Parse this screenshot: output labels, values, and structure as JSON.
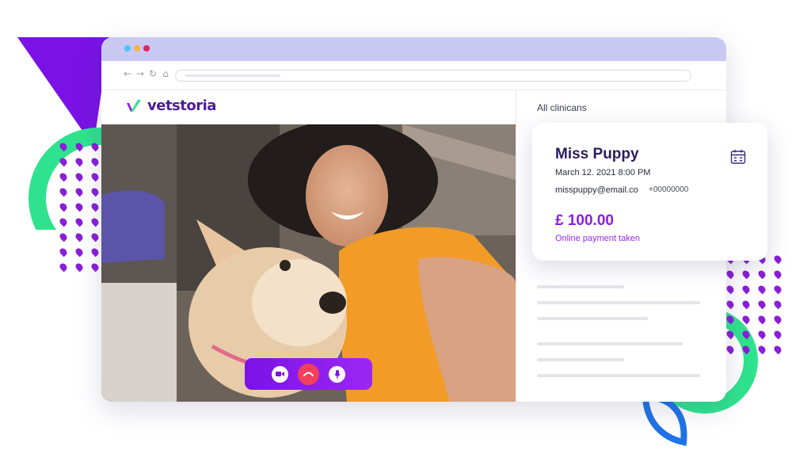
{
  "colors": {
    "brand_purple": "#4a1d9b",
    "accent_purple": "#8a1ee0",
    "titlebar": "#c9c8f3",
    "end_call_red": "#f2405b",
    "deco_green": "#2fe38e",
    "deco_blue": "#1f73e8"
  },
  "browser": {
    "window_dots": [
      "#4fc3f7",
      "#f5b342",
      "#e0245e"
    ],
    "nav_icons": [
      "back-arrow-icon",
      "forward-arrow-icon",
      "reload-icon",
      "home-icon"
    ]
  },
  "app": {
    "logo_text": "vetstoria"
  },
  "sidebar": {
    "filter_label": "All clinicans"
  },
  "appointment": {
    "name": "Miss Puppy",
    "date": "March 12. 2021 8:00 PM",
    "email": "misspuppy@email.co",
    "phone": "+00000000",
    "amount": "£ 100.00",
    "payment_status": "Online payment taken",
    "icon": "calendar-icon"
  },
  "call_controls": {
    "buttons": [
      "camera-icon",
      "end-call-icon",
      "microphone-icon"
    ]
  }
}
